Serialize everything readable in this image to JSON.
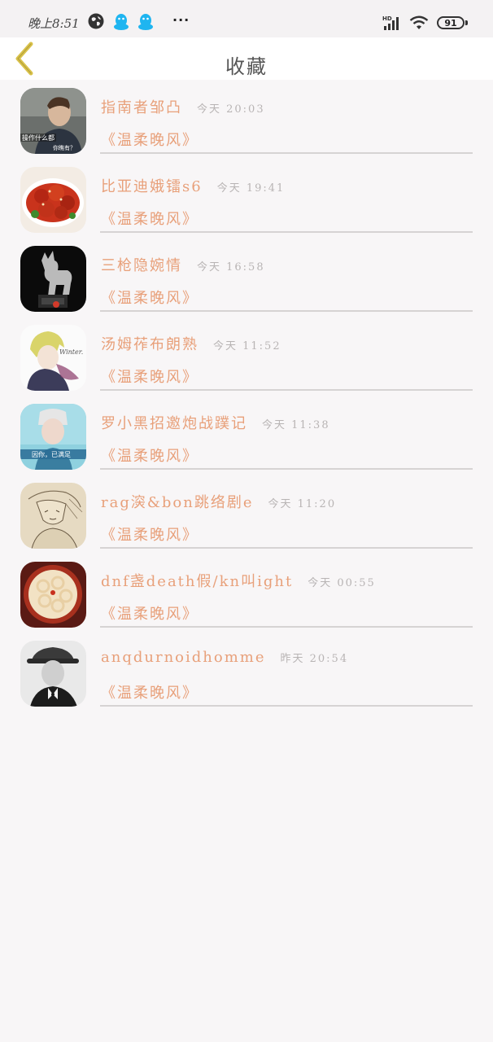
{
  "status_bar": {
    "time": "晚上8:51",
    "more": "···",
    "signal_label": "HD",
    "battery": "91",
    "icons": [
      "globe-icon",
      "qq-icon",
      "qq-icon",
      "signal-icon",
      "wifi-icon",
      "battery-icon"
    ]
  },
  "header": {
    "title": "收藏",
    "back_icon": "chevron-left-icon"
  },
  "colors": {
    "accent": "#e8a07a",
    "back_arrow": "#d9c24a",
    "muted": "#b8b4b4"
  },
  "favorites": [
    {
      "name": "指南者邹凸",
      "time": "今天 20:03",
      "source": "《温柔晚风》",
      "avatar_caption_1": "操作什么都",
      "avatar_caption_2": "你瞧有？"
    },
    {
      "name": "比亚迪娥镭s6",
      "time": "今天 19:41",
      "source": "《温柔晚风》"
    },
    {
      "name": "三枪隐婉情",
      "time": "今天 16:58",
      "source": "《温柔晚风》"
    },
    {
      "name": "汤姆莋布朗熟",
      "time": "今天 11:52",
      "source": "《温柔晚风》",
      "avatar_caption_1": "Winter."
    },
    {
      "name": "罗小黑招邀炮战蹼记",
      "time": "今天 11:38",
      "source": "《温柔晚风》",
      "avatar_caption_1": "因你，已满足"
    },
    {
      "name": "rag㴱&bon跳络剧e",
      "time": "今天 11:20",
      "source": "《温柔晚风》"
    },
    {
      "name": "dnf盏death假/kn叫ight",
      "time": "今天 00:55",
      "source": "《温柔晚风》"
    },
    {
      "name": "anqdurnoidhomme",
      "time": "昨天 20:54",
      "source": "《温柔晚风》"
    }
  ]
}
